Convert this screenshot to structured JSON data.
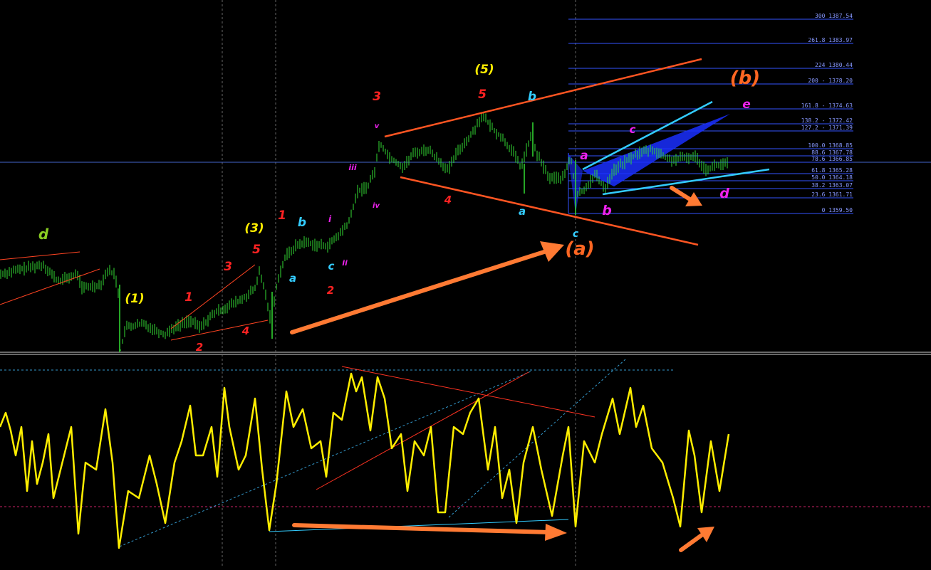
{
  "chart_data": {
    "type": "line",
    "panels": [
      "price",
      "oscillator"
    ],
    "colors": {
      "background": "#000000",
      "candle": "#33dd33",
      "oscillator": "#ffee00",
      "fib_line": "#3355ff",
      "fib_text": "#8899ff",
      "orange": "#ff5522",
      "cyan": "#33ccff",
      "arrow": "#ff7a33"
    },
    "fibonacci_levels": [
      {
        "label": "300 1387.54"
      },
      {
        "label": "261.8 1383.97"
      },
      {
        "label": "224 1380.44"
      },
      {
        "label": "200 - 1378.20"
      },
      {
        "label": "161.8 - 1374.63"
      },
      {
        "label": "138.2 - 1372.42"
      },
      {
        "label": "127.2 - 1371.39"
      },
      {
        "label": "100.0 1368.85"
      },
      {
        "label": "88.6 1367.78"
      },
      {
        "label": "78.6 1366.85"
      },
      {
        "label": "61.8 1365.28"
      },
      {
        "label": "50.0 1364.18"
      },
      {
        "label": "38.2 1363.07"
      },
      {
        "label": "23.6 1361.71"
      },
      {
        "label": "0 1359.50"
      }
    ],
    "wave_labels": [
      {
        "id": "d-left",
        "text": "d",
        "color": "#88cc22"
      },
      {
        "id": "one-paren",
        "text": "(1)",
        "color": "#ffee00"
      },
      {
        "id": "red-1",
        "text": "1",
        "color": "#ff2222"
      },
      {
        "id": "red-2",
        "text": "2",
        "color": "#ff2222"
      },
      {
        "id": "red-3a",
        "text": "3",
        "color": "#ff2222"
      },
      {
        "id": "red-4a",
        "text": "4",
        "color": "#ff2222"
      },
      {
        "id": "red-5a",
        "text": "5",
        "color": "#ff2222"
      },
      {
        "id": "three-paren",
        "text": "(3)",
        "color": "#ffee00"
      },
      {
        "id": "cyan-a1",
        "text": "a",
        "color": "#33ccff"
      },
      {
        "id": "cyan-b1",
        "text": "b",
        "color": "#33ccff"
      },
      {
        "id": "cyan-c1",
        "text": "c",
        "color": "#33ccff"
      },
      {
        "id": "red-1b",
        "text": "1",
        "color": "#ff2222"
      },
      {
        "id": "red-2b",
        "text": "2",
        "color": "#ff2222"
      },
      {
        "id": "mag-i",
        "text": "i",
        "color": "#ee22ee"
      },
      {
        "id": "mag-ii",
        "text": "ii",
        "color": "#ee22ee"
      },
      {
        "id": "mag-iii",
        "text": "iii",
        "color": "#ee22ee"
      },
      {
        "id": "mag-iv",
        "text": "iv",
        "color": "#ee22ee"
      },
      {
        "id": "mag-v",
        "text": "v",
        "color": "#ee22ee"
      },
      {
        "id": "red-3b",
        "text": "3",
        "color": "#ff2222"
      },
      {
        "id": "red-4b",
        "text": "4",
        "color": "#ff2222"
      },
      {
        "id": "red-5b",
        "text": "5",
        "color": "#ff2222"
      },
      {
        "id": "five-paren",
        "text": "(5)",
        "color": "#ffee00"
      },
      {
        "id": "cyan-b2",
        "text": "b",
        "color": "#33ccff"
      },
      {
        "id": "cyan-a2",
        "text": "a",
        "color": "#33ccff"
      },
      {
        "id": "cyan-c2",
        "text": "c",
        "color": "#33ccff"
      },
      {
        "id": "orange-a-paren",
        "text": "(a)",
        "color": "#ff6622"
      },
      {
        "id": "mag-a",
        "text": "a",
        "color": "#ee22ee"
      },
      {
        "id": "mag-b",
        "text": "b",
        "color": "#ee22ee"
      },
      {
        "id": "mag-c",
        "text": "c",
        "color": "#ee22ee"
      },
      {
        "id": "mag-d",
        "text": "d",
        "color": "#ee22ee"
      },
      {
        "id": "mag-e",
        "text": "e",
        "color": "#ee22ee"
      },
      {
        "id": "orange-b-paren",
        "text": "(b)",
        "color": "#ff6622"
      }
    ]
  }
}
